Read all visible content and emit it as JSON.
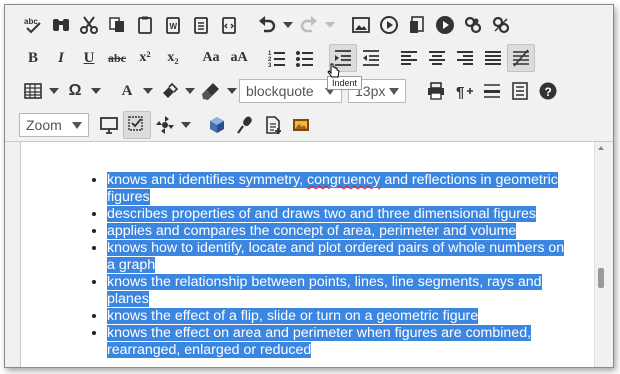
{
  "toolbar": {
    "row1": [
      "spellcheck-icon",
      "find-icon",
      "cut-icon",
      "copy-icon",
      "paste-icon",
      "paste-word-icon",
      "paste-text-icon",
      "paste-html-icon",
      "undo-icon",
      "redo-icon",
      "image-icon",
      "media-icon",
      "document-icon",
      "play-icon",
      "link-icon",
      "unlink-icon"
    ],
    "bold": "B",
    "italic": "I",
    "underline": "U",
    "strike": "abc",
    "superscript": "x²",
    "subscript": "x₂",
    "font_size_smaller": "Aa",
    "font_size_larger": "aA",
    "font_color": "A",
    "omega": "Ω",
    "block_format": "blockquote",
    "font_size": "13px",
    "zoom": "Zoom"
  },
  "tooltip": "Indent",
  "content": {
    "items": [
      {
        "before": "knows and identifies symmetry, ",
        "misspelled": "congruency",
        "after": " and reflections in geometric figures"
      },
      {
        "before": "describes properties of and draws two and three dimensional figures",
        "misspelled": "",
        "after": ""
      },
      {
        "before": "applies and compares the concept of area, perimeter and volume",
        "misspelled": "",
        "after": ""
      },
      {
        "before": "knows how to identify, locate and plot ordered pairs of whole numbers on a graph",
        "misspelled": "",
        "after": ""
      },
      {
        "before": "knows the relationship between points, lines, line segments, rays and planes",
        "misspelled": "",
        "after": ""
      },
      {
        "before": "knows the effect of a flip, slide or turn on a geometric figure",
        "misspelled": "",
        "after": ""
      },
      {
        "before": "knows the effect on area and perimeter when figures are combined, rearranged, enlarged or reduced",
        "misspelled": "",
        "after": ""
      }
    ]
  },
  "colors": {
    "selection": "#3b86e0",
    "toolbar_bg": "#f1f1f1",
    "active_button": "#dcdcdc"
  }
}
